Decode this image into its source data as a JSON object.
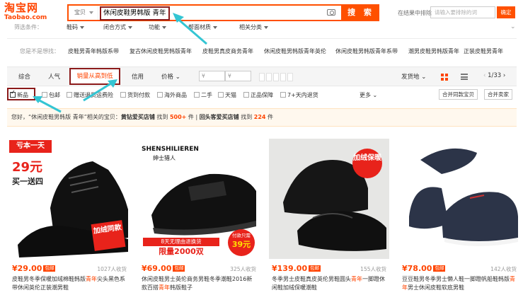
{
  "header": {
    "logo_zh": "淘宝网",
    "logo_en": "Taobao.com",
    "search_scope": "宝贝",
    "search_query": "休闲皮鞋男韩版 青年",
    "search_button": "搜 索",
    "exclude_label": "在结果中排除",
    "exclude_placeholder": "请输入要排除的词",
    "exclude_button": "确定"
  },
  "filters": {
    "label": "筛选条件：",
    "items": [
      "鞋码",
      "闭合方式",
      "功能",
      "帮面材质",
      "相关分类"
    ]
  },
  "suggestions": {
    "label": "您是不是想找：",
    "items": [
      "皮鞋男青年韩版系带",
      "复古休闲皮鞋男韩版青年",
      "皮鞋男真皮商务青年",
      "休闲皮鞋男韩版青年英伦",
      "休闲皮鞋男韩版青年系带",
      "潮男皮鞋男韩版青年",
      "正装皮鞋男青年"
    ]
  },
  "sortbar": {
    "tabs": [
      "综合",
      "人气",
      "销量从高到低",
      "信用",
      "价格"
    ],
    "price_from": "¥",
    "price_to": "¥",
    "ship_from": "发货地",
    "page": "1/33"
  },
  "checkboxes": {
    "items": [
      "新品",
      "包邮",
      "赠送退货运费险",
      "货到付款",
      "海外商品",
      "二手",
      "天猫",
      "正品保障",
      "7+天内退货"
    ],
    "more": "更多",
    "merge_same": "合并同款宝贝",
    "merge_seller": "合并卖家"
  },
  "notice": {
    "p1": "您好，“",
    "query": "休闲皮鞋男韩版 青年",
    "p2": "”相关的宝贝：",
    "shop1": "黄钻爱买店铺",
    "p3": " 找到 ",
    "count1": "500+",
    "p4": " 件  |  ",
    "shop2": "回头客爱买店铺",
    "p5": " 找到 ",
    "count2": "224",
    "p6": " 件"
  },
  "products": [
    {
      "price": "¥29.00",
      "tag": "包邮",
      "sold": "1027人收货",
      "title_a": "皮鞋男冬季保暖加绒棉鞋韩版",
      "title_kw": "青年",
      "title_b": "尖头黑色系带休闲英伦正装潮男鞋",
      "img_banner": "亏本一天",
      "img_price": "29元",
      "img_deal": "买一送四",
      "img_badge": "加绒同款"
    },
    {
      "price": "¥69.00",
      "tag": "包邮",
      "sold": "325人收货",
      "title_a": "休闲皮鞋男士英伦商务男鞋冬季潮鞋2016新款百搭",
      "title_kw": "青年",
      "title_b": "韩版鞋子",
      "img_brand": "SHENSHILIEREN",
      "img_brand_zh": "绅士猎人",
      "img_banner": "8天无理由退换货",
      "img_limit": "限量2000双",
      "img_pay": "付款只需",
      "img_pay_price": "39元"
    },
    {
      "price": "¥139.00",
      "tag": "包邮",
      "sold": "155人收货",
      "title_a": "冬季男士皮鞋真皮英伦男鞋圆头",
      "title_kw": "青年",
      "title_b": "一脚蹬休闲鞋加绒保暖潮鞋",
      "img_badge": "加绒保暖"
    },
    {
      "price": "¥78.00",
      "tag": "包邮",
      "sold": "142人收货",
      "title_a": "豆豆鞋男冬季男士懒人鞋一脚蹬帆船鞋韩版",
      "title_kw": "青年",
      "title_b": "男士休闲皮鞋软底男鞋"
    }
  ],
  "colors": {
    "accent": "#ff4400",
    "annotation_box": "#8b1a1a",
    "annotation_arrow": "#34c5d3"
  }
}
